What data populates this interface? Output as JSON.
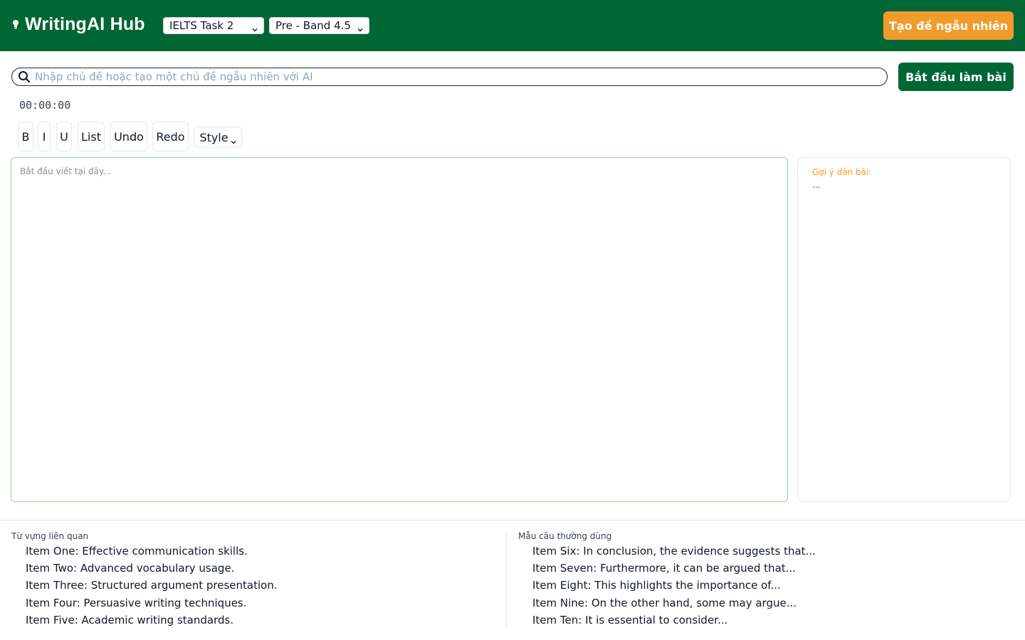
{
  "header": {
    "brand": "WritingAI Hub",
    "brand_icon": "lightbulb-icon",
    "task_select": {
      "value": "IELTS Task 2",
      "icon": "chevron-down-icon"
    },
    "band_select": {
      "value": "Pre - Band 4.5",
      "icon": "chevron-down-icon"
    },
    "random_topic_button": "Tạo đề ngẫu nhiên"
  },
  "search": {
    "icon": "search-icon",
    "placeholder": "Nhập chủ đề hoặc tạo một chủ đề ngẫu nhiên với AI",
    "value": ""
  },
  "start_button": "Bắt đầu làm bài",
  "timer": "00:00:00",
  "toolbar": {
    "bold": "B",
    "italic": "I",
    "underline": "U",
    "list": "List",
    "undo": "Undo",
    "redo": "Redo",
    "style": "Style"
  },
  "editor": {
    "placeholder": "Bắt đầu viết tại đây..."
  },
  "hints": {
    "title": "Gợi ý dàn bài:",
    "body": "..."
  },
  "vocabulary": {
    "heading": "Từ vựng liên quan",
    "items": [
      "Item One: Effective communication skills.",
      "Item Two: Advanced vocabulary usage.",
      "Item Three: Structured argument presentation.",
      "Item Four: Persuasive writing techniques.",
      "Item Five: Academic writing standards."
    ]
  },
  "phrases": {
    "heading": "Mẫu câu thường dùng",
    "items": [
      "Item Six: In conclusion, the evidence suggests that...",
      "Item Seven: Furthermore, it can be argued that...",
      "Item Eight: This highlights the importance of...",
      "Item Nine: On the other hand, some may argue...",
      "Item Ten: It is essential to consider..."
    ]
  },
  "colors": {
    "header_bg": "#006634",
    "accent_orange": "#f19b2c",
    "editor_border": "#9fd19a"
  }
}
